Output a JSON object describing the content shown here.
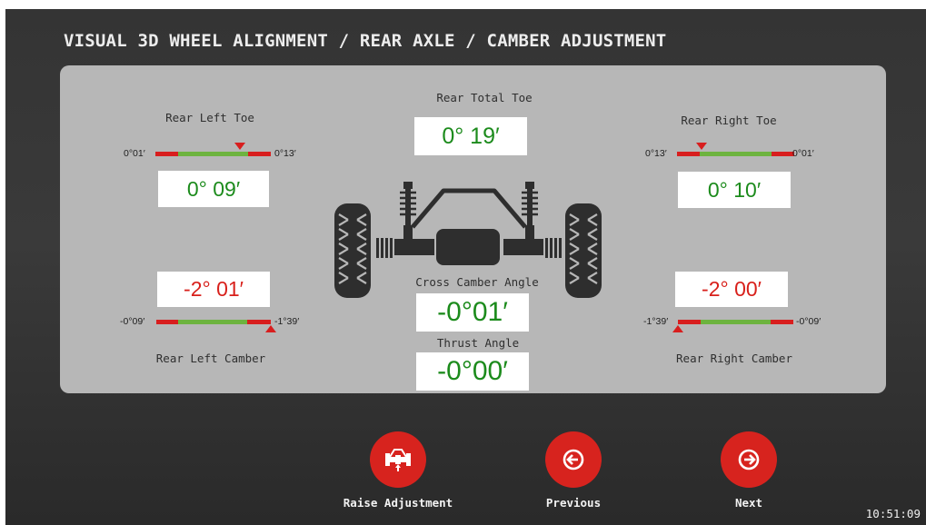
{
  "header": {
    "title": "VISUAL 3D WHEEL ALIGNMENT / REAR AXLE / CAMBER ADJUSTMENT"
  },
  "panel": {
    "rear_total_toe": {
      "label": "Rear Total Toe",
      "value": "0° 19′"
    },
    "rear_left_toe": {
      "label": "Rear Left Toe",
      "value": "0° 09′",
      "min": "0°01′",
      "max": "0°13′",
      "marker_fraction": 0.73
    },
    "rear_right_toe": {
      "label": "Rear Right Toe",
      "value": "0° 10′",
      "min": "0°13′",
      "max": "0°01′",
      "marker_fraction": 0.21
    },
    "rear_left_camber": {
      "label": "Rear Left Camber",
      "value": "-2° 01′",
      "min": "-0°09′",
      "max": "-1°39′",
      "marker_fraction": 1.0
    },
    "rear_right_camber": {
      "label": "Rear Right Camber",
      "value": "-2° 00′",
      "min": "-1°39′",
      "max": "-0°09′",
      "marker_fraction": 0.0
    },
    "cross_camber": {
      "label": "Cross Camber Angle",
      "value": "-0°01′"
    },
    "thrust_angle": {
      "label": "Thrust Angle",
      "value": "-0°00′"
    }
  },
  "buttons": {
    "raise": "Raise Adjustment",
    "previous": "Previous",
    "next": "Next"
  },
  "clock": "10:51:09",
  "colors": {
    "accent": "#d7231e",
    "value_green": "#1c8b1c",
    "value_red": "#d8201b",
    "gauge_green": "#6db33f"
  },
  "icons": {
    "raise": "axle-lift-icon",
    "previous": "arrow-left-circle-icon",
    "next": "arrow-right-circle-icon"
  }
}
